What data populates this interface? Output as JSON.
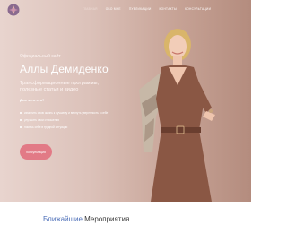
{
  "nav": {
    "items": [
      {
        "label": "Главная"
      },
      {
        "label": "Обо мне"
      },
      {
        "label": "Публикации"
      },
      {
        "label": "Контакты"
      },
      {
        "label": "Консультации"
      }
    ]
  },
  "hero": {
    "eyebrow": "Официальный сайт",
    "title": "Аллы Демиденко",
    "subtitle_line1": "Трансформационные программы,",
    "subtitle_line2": "полезные статьи и видео",
    "section_label": "Для чего это?",
    "bullets": [
      "изменить свою жизнь к лучшему и вернуть уверенность в себе",
      "улучшить свои отношения",
      "помочь себе в трудной ситуации"
    ],
    "cta_label": "Консультация"
  },
  "events": {
    "title_accent": "Ближайшие",
    "title_rest": "Мероприятия"
  },
  "colors": {
    "cta": "#e27a86",
    "accent_title": "#4d6fb8"
  }
}
